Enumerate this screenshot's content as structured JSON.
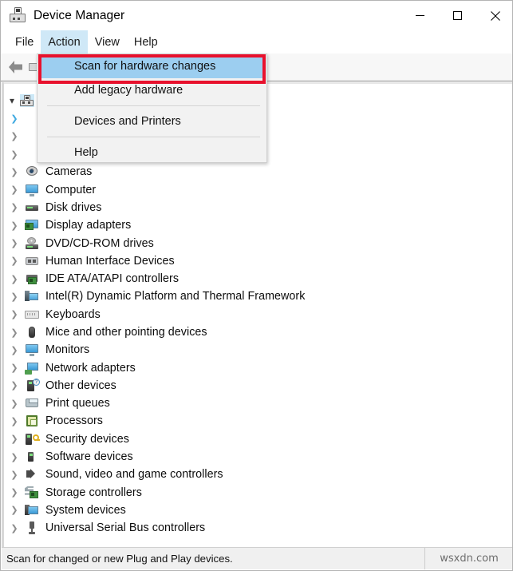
{
  "window": {
    "title": "Device Manager",
    "icon": "device-manager-icon",
    "controls": {
      "minimize": "minimize-icon",
      "maximize": "maximize-icon",
      "close": "close-icon"
    }
  },
  "menubar": {
    "items": [
      {
        "label": "File",
        "active": false
      },
      {
        "label": "Action",
        "active": true
      },
      {
        "label": "View",
        "active": false
      },
      {
        "label": "Help",
        "active": false
      }
    ]
  },
  "toolbar": {
    "back": "back-arrow-icon",
    "stop": "stop-icon"
  },
  "dropdown": {
    "open_from": "Action",
    "highlight_color": "#9ccef0",
    "focus_ring_color": "#e8112d",
    "items": [
      {
        "label": "Scan for hardware changes",
        "highlighted": true,
        "separator_after": false
      },
      {
        "label": "Add legacy hardware",
        "highlighted": false,
        "separator_after": true
      },
      {
        "label": "Devices and Printers",
        "highlighted": false,
        "separator_after": true
      },
      {
        "label": "Help",
        "highlighted": false,
        "separator_after": false
      }
    ]
  },
  "tree": {
    "root": {
      "label": "",
      "icon": "computer-root-icon",
      "expanded": true,
      "selected": true
    },
    "hidden_rows": 3,
    "items": [
      {
        "label": "Cameras",
        "icon": "camera-icon"
      },
      {
        "label": "Computer",
        "icon": "computer-icon"
      },
      {
        "label": "Disk drives",
        "icon": "disk-drive-icon"
      },
      {
        "label": "Display adapters",
        "icon": "display-adapter-icon"
      },
      {
        "label": "DVD/CD-ROM drives",
        "icon": "dvd-drive-icon"
      },
      {
        "label": "Human Interface Devices",
        "icon": "hid-icon"
      },
      {
        "label": "IDE ATA/ATAPI controllers",
        "icon": "ide-controller-icon"
      },
      {
        "label": "Intel(R) Dynamic Platform and Thermal Framework",
        "icon": "intel-platform-icon"
      },
      {
        "label": "Keyboards",
        "icon": "keyboard-icon"
      },
      {
        "label": "Mice and other pointing devices",
        "icon": "mouse-icon"
      },
      {
        "label": "Monitors",
        "icon": "monitor-icon"
      },
      {
        "label": "Network adapters",
        "icon": "network-adapter-icon"
      },
      {
        "label": "Other devices",
        "icon": "other-device-icon"
      },
      {
        "label": "Print queues",
        "icon": "printer-icon"
      },
      {
        "label": "Processors",
        "icon": "processor-icon"
      },
      {
        "label": "Security devices",
        "icon": "security-device-icon"
      },
      {
        "label": "Software devices",
        "icon": "software-device-icon"
      },
      {
        "label": "Sound, video and game controllers",
        "icon": "sound-controller-icon"
      },
      {
        "label": "Storage controllers",
        "icon": "storage-controller-icon"
      },
      {
        "label": "System devices",
        "icon": "system-device-icon"
      },
      {
        "label": "Universal Serial Bus controllers",
        "icon": "usb-controller-icon"
      }
    ]
  },
  "statusbar": {
    "message": "Scan for changed or new Plug and Play devices.",
    "watermark": "wsxdn.com"
  }
}
